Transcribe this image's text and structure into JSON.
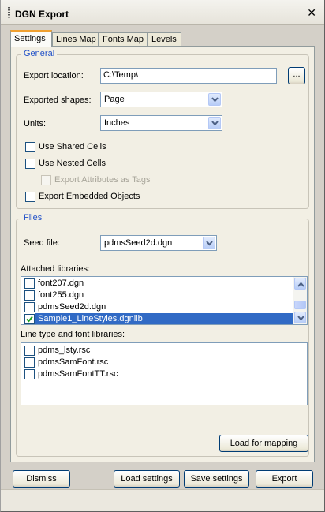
{
  "window": {
    "title": "DGN Export",
    "close_glyph": "✕"
  },
  "tabs": [
    {
      "label": "Settings",
      "active": true
    },
    {
      "label": "Lines Map",
      "active": false
    },
    {
      "label": "Fonts Map",
      "active": false
    },
    {
      "label": "Levels",
      "active": false
    }
  ],
  "general": {
    "title": "General",
    "export_location_label": "Export location:",
    "export_location_value": "C:\\Temp\\",
    "browse_label": "...",
    "exported_shapes_label": "Exported shapes:",
    "exported_shapes_value": "Page",
    "units_label": "Units:",
    "units_value": "Inches",
    "use_shared_cells": {
      "label": "Use Shared Cells",
      "checked": false
    },
    "use_nested_cells": {
      "label": "Use Nested Cells",
      "checked": false
    },
    "export_attributes_as_tags": {
      "label": "Export Attributes as Tags",
      "checked": false,
      "enabled": false
    },
    "export_embedded_objects": {
      "label": "Export Embedded Objects",
      "checked": false
    }
  },
  "files": {
    "title": "Files",
    "seed_file_label": "Seed file:",
    "seed_file_value": "pdmsSeed2d.dgn",
    "attached_libraries_label": "Attached libraries:",
    "attached_libraries": [
      {
        "name": "font207.dgn",
        "checked": false,
        "selected": false
      },
      {
        "name": "font255.dgn",
        "checked": false,
        "selected": false
      },
      {
        "name": "pdmsSeed2d.dgn",
        "checked": false,
        "selected": false
      },
      {
        "name": "Sample1_LineStyles.dgnlib",
        "checked": true,
        "selected": true
      }
    ],
    "line_type_font_libraries_label": "Line type and font libraries:",
    "line_type_font_libraries": [
      {
        "name": "pdms_lsty.rsc",
        "checked": false
      },
      {
        "name": "pdmsSamFont.rsc",
        "checked": false
      },
      {
        "name": "pdmsSamFontTT.rsc",
        "checked": false
      }
    ],
    "load_for_mapping_label": "Load for mapping"
  },
  "footer": {
    "dismiss_label": "Dismiss",
    "load_settings_label": "Load settings",
    "save_settings_label": "Save settings",
    "export_label": "Export"
  },
  "colors": {
    "accent_tab": "#f0a030",
    "group_title": "#2050c8",
    "selection": "#316ac5",
    "checkmark": "#21a121"
  }
}
